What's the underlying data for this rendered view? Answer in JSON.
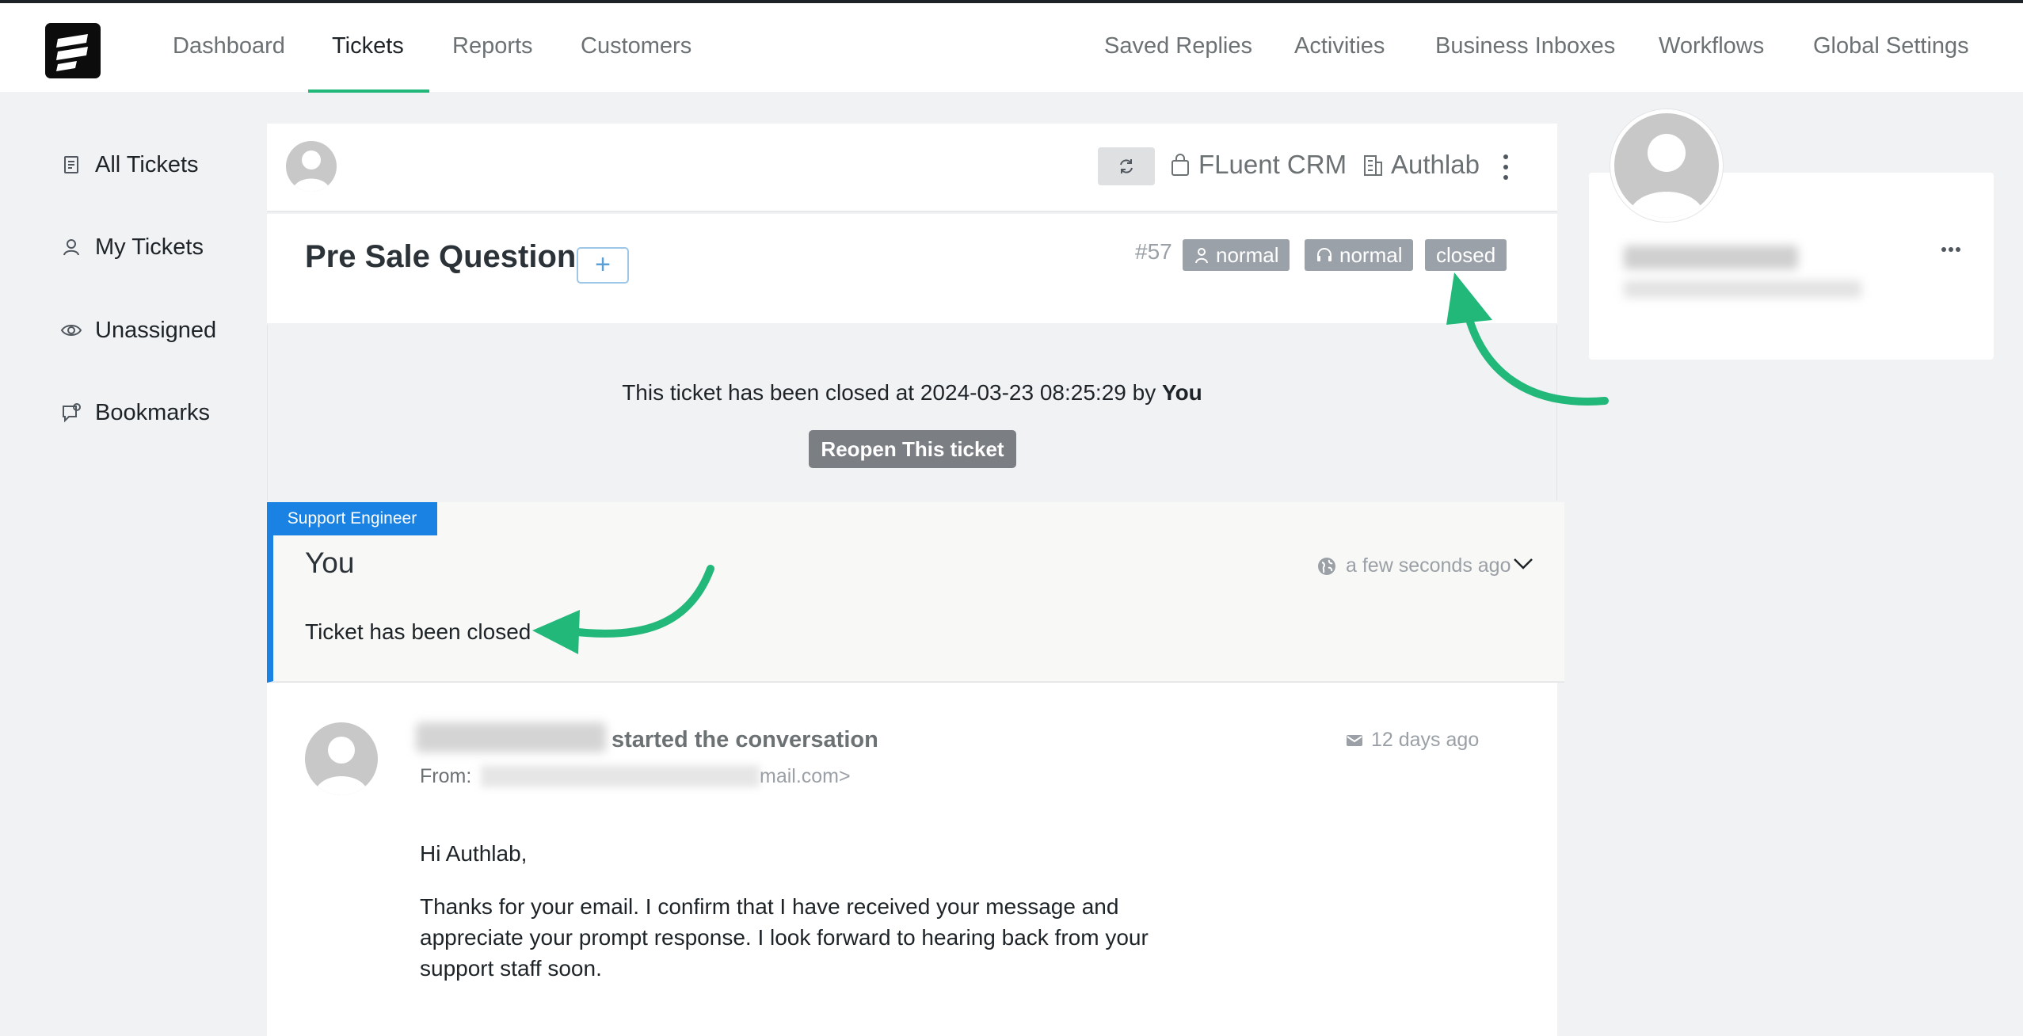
{
  "topnav": {
    "left": [
      "Dashboard",
      "Tickets",
      "Reports",
      "Customers"
    ],
    "right": [
      "Saved Replies",
      "Activities",
      "Business Inboxes",
      "Workflows",
      "Global Settings"
    ],
    "active": "Tickets"
  },
  "sidebar": {
    "items": [
      {
        "label": "All Tickets",
        "icon": "document-icon"
      },
      {
        "label": "My Tickets",
        "icon": "user-icon"
      },
      {
        "label": "Unassigned",
        "icon": "eye-icon"
      },
      {
        "label": "Bookmarks",
        "icon": "bookmark-icon"
      }
    ]
  },
  "ticket_header": {
    "product": "FLuent CRM",
    "business": "Authlab"
  },
  "ticket": {
    "title": "Pre Sale Question",
    "add_label": "+",
    "number": "#57",
    "badges": [
      "normal",
      "normal",
      "closed"
    ]
  },
  "closed_notice": {
    "text": "This ticket has been closed at 2024-03-23 08:25:29 by",
    "by": "You",
    "reopen_label": "Reopen This ticket"
  },
  "reply": {
    "role": "Support Engineer",
    "author": "You",
    "time": "a few seconds ago",
    "body": "Ticket has been closed"
  },
  "conversation": {
    "action": "started the conversation",
    "from_label": "From:",
    "email_tail": "mail.com>",
    "time": "12 days ago",
    "greeting": "Hi Authlab,",
    "body": "Thanks for your email. I confirm that I have received your message and appreciate your prompt response. I look forward to hearing back from your support staff soon."
  },
  "colors": {
    "accent": "#22b87a",
    "brand_blue": "#1a82e2",
    "badge_gray": "#9aa1a8"
  }
}
